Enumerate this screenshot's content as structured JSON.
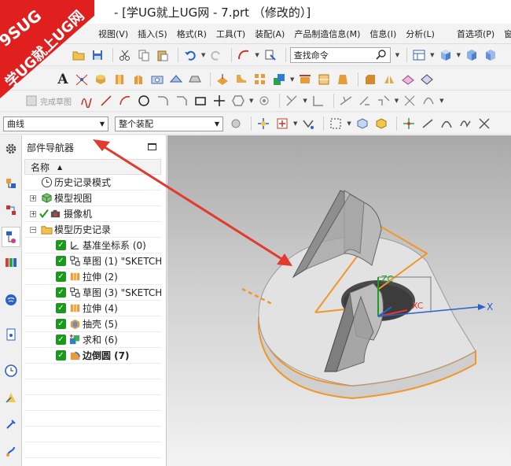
{
  "window": {
    "title": "- [学UG就上UG网 - 7.prt （修改的）]"
  },
  "watermark": {
    "site_code": "9SUG",
    "slogan": "学UG就上UG网"
  },
  "menu": {
    "items": [
      "视图(V)",
      "插入(S)",
      "格式(R)",
      "工具(T)",
      "装配(A)",
      "产品制造信息(M)",
      "信息(I)",
      "分析(L)",
      "首选项(P)",
      "窗"
    ]
  },
  "toolbar": {
    "command_finder_placeholder": "查找命令",
    "finish_sketch_label": "完成草图",
    "selection_filter_value": "曲线",
    "selection_scope_value": "整个装配"
  },
  "navigator": {
    "title": "部件导航器",
    "column_header": "名称",
    "items": [
      {
        "label": "历史记录模式",
        "icon": "clock-icon",
        "level": 0
      },
      {
        "label": "模型视图",
        "icon": "model-views-icon",
        "level": 0
      },
      {
        "label": "摄像机",
        "icon": "camera-icon",
        "level": 0
      },
      {
        "label": "模型历史记录",
        "icon": "folder-icon",
        "level": 0
      },
      {
        "label": "基准坐标系 (0)",
        "icon": "datum-csys-icon",
        "level": 1
      },
      {
        "label": "草图 (1) \"SKETCH",
        "icon": "sketch-icon",
        "level": 1
      },
      {
        "label": "拉伸 (2)",
        "icon": "extrude-icon",
        "level": 1
      },
      {
        "label": "草图 (3) \"SKETCH",
        "icon": "sketch-icon",
        "level": 1
      },
      {
        "label": "拉伸 (4)",
        "icon": "extrude-icon",
        "level": 1
      },
      {
        "label": "抽壳 (5)",
        "icon": "shell-icon",
        "level": 1
      },
      {
        "label": "求和 (6)",
        "icon": "unite-icon",
        "level": 1
      },
      {
        "label": "边倒圆 (7)",
        "icon": "edge-blend-icon",
        "level": 1
      }
    ]
  },
  "viewport": {
    "axis_labels": {
      "zc": "ZC",
      "xc": "XC",
      "x": "X"
    }
  },
  "colors": {
    "watermark_red": "#e0201e",
    "highlight_orange": "#f0962a",
    "check_green": "#1a9a1a",
    "arrow_red": "#e23a2e"
  }
}
